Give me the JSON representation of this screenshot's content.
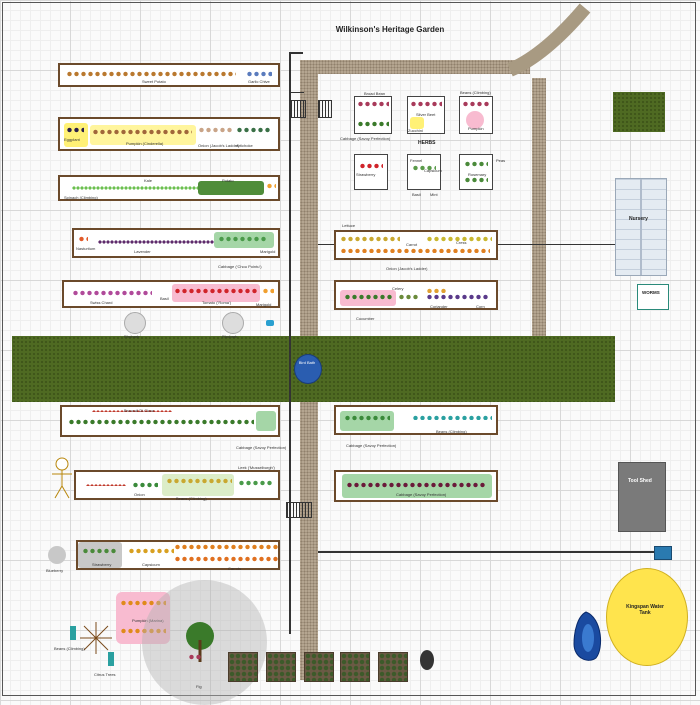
{
  "title": "Wilkinson's Heritage Garden",
  "labels": {
    "herbs": "HERBS",
    "nursery": "Nursery",
    "worms": "WORMS",
    "tool_shed": "Tool Shed",
    "bird_bath": "Bird Bath",
    "water_tank": "Kingspan Water Tank",
    "compost": "Compost"
  },
  "beds": {
    "r1": [
      "Sweet Potato",
      "Garlic Chive"
    ],
    "r2": [
      "Eggplant",
      "Pumpkin (Cinderella)",
      "Onion (Jacob's Ladder)",
      "Artichoke"
    ],
    "r3": [
      "Kale",
      "Potato",
      "Spinach (Climbing)"
    ],
    "r4": [
      "Nasturtium",
      "Lavender",
      "Cabbage ('Chou Pointu')",
      "Marigold"
    ],
    "r5": [
      "Swiss Chard",
      "Basil",
      "Tomato ('Roma')",
      "Marigold"
    ],
    "r6": [
      "Broccoli Di Cicco",
      "Cabbage (Savoy Perfection)"
    ],
    "r7": [
      "Onion",
      "Leek ('Musselburgh')",
      "Beans (Climbing)"
    ],
    "r8": [
      "Strawberry",
      "Capsicum",
      "Carrots"
    ],
    "c1": [
      "Lettuce",
      "Carrot",
      "Onion (Jacob's Ladder)",
      "Cress"
    ],
    "c2": [
      "Cucumber",
      "Celery",
      "Coriander",
      "Corn"
    ],
    "c3": [
      "Cabbage (Savoy Perfection)",
      "Beans (Climbing)"
    ],
    "c4": [
      "Cabbage (Savoy Perfection)"
    ]
  },
  "herb_boxes": [
    "Broad Bean",
    "Cabbage (Savoy Perfection)",
    "Silver Beet",
    "Zucchini",
    "Beans (Climbing)",
    "Pumpkin",
    "Strawberry",
    "Fennel",
    "Capsicum",
    "Basil",
    "Mint",
    "Rosemary",
    "Peas"
  ],
  "misc": {
    "blueberry": "Blueberry",
    "rhubarb": "Rhubarb",
    "pumpkin_patch": "Pumpkin (Marina)",
    "fig": "Fig",
    "beans_climbing": "Beans (Climbing)",
    "citrus": "Citrus Trees",
    "scarecrow": "Scarecrow"
  },
  "colors": {
    "lawn": "#4f6a22",
    "gravel": "#b4a590",
    "bed_frame": "#6b4a2b",
    "water_tank": "#ffe44d",
    "bird_bath": "#2a5db0"
  }
}
